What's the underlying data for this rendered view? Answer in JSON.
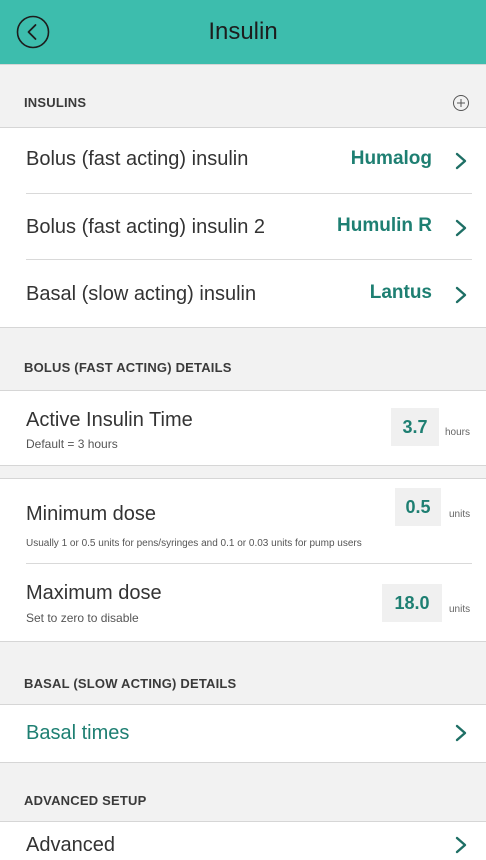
{
  "header": {
    "title": "Insulin",
    "back_icon": "circle-chevron-left-icon"
  },
  "sections": {
    "insulins": {
      "title": "INSULINS",
      "add_icon": "circle-plus-icon"
    },
    "bolus_details": {
      "title": "BOLUS (FAST ACTING) DETAILS"
    },
    "basal_details": {
      "title": "BASAL (SLOW ACTING) DETAILS"
    },
    "advanced_setup": {
      "title": "ADVANCED SETUP"
    }
  },
  "insulins": [
    {
      "label": "Bolus (fast acting) insulin",
      "value": "Humalog"
    },
    {
      "label": "Bolus (fast acting) insulin 2",
      "value": "Humulin R"
    },
    {
      "label": "Basal (slow acting) insulin",
      "value": "Lantus"
    }
  ],
  "active_insulin_time": {
    "label": "Active Insulin Time",
    "sub": "Default = 3 hours",
    "value": "3.7",
    "unit": "hours"
  },
  "minimum_dose": {
    "label": "Minimum dose",
    "sub": "Usually 1 or 0.5 units for pens/syringes and 0.1 or 0.03 units for pump users",
    "value": "0.5",
    "unit": "units"
  },
  "maximum_dose": {
    "label": "Maximum dose",
    "sub": "Set to zero to disable",
    "value": "18.0",
    "unit": "units"
  },
  "basal_times": {
    "label": "Basal times"
  },
  "advanced": {
    "label": "Advanced"
  },
  "colors": {
    "header_bg": "#3dbdad",
    "accent": "#1e7f72",
    "section_bg": "#f2f2f2"
  }
}
